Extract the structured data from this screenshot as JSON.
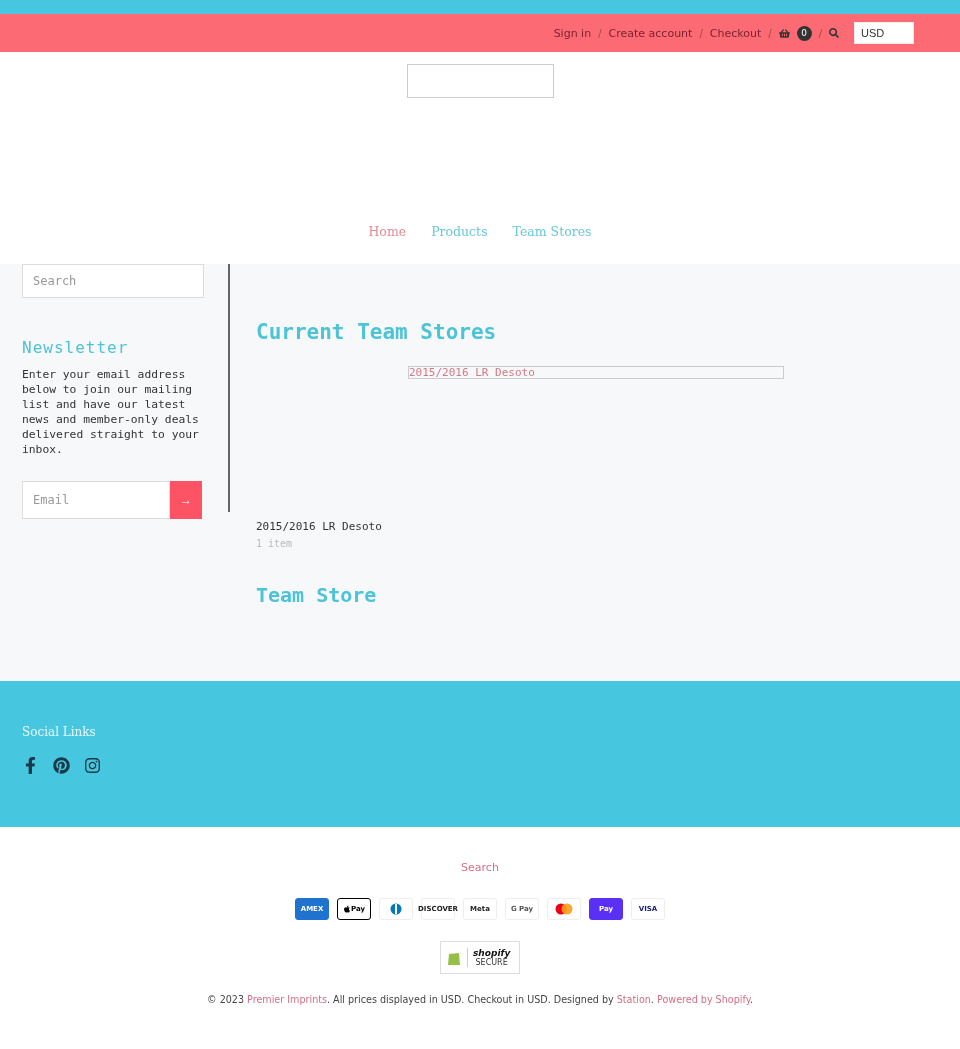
{
  "top_nav": {
    "links": [
      {
        "label": "Sign in"
      },
      {
        "label": "Create account"
      },
      {
        "label": "Checkout"
      }
    ],
    "separators": [
      "/",
      "/",
      "/",
      "/"
    ],
    "cart_count": "0",
    "currency": "USD"
  },
  "main_nav": [
    {
      "label": "Home",
      "selected": true
    },
    {
      "label": "Products",
      "selected": false
    },
    {
      "label": "Team Stores",
      "selected": false
    }
  ],
  "sidebar": {
    "search_placeholder": "Search",
    "newsletter_title": "Newsletter",
    "newsletter_text": "Enter your email address below to join our mailing list and have our latest news and member-only deals delivered straight to your inbox.",
    "email_placeholder": "Email",
    "submit_label": "→"
  },
  "content": {
    "title": "Current Team Stores",
    "collections": [
      {
        "image_alt": "2015/2016 LR Desoto",
        "name": "2015/2016 LR Desoto",
        "count": "1 item"
      }
    ],
    "section_title": "Team Store"
  },
  "footer": {
    "social_title": "Social Links",
    "search_link": "Search",
    "payments": [
      {
        "kind": "amex",
        "label": "AMEX"
      },
      {
        "kind": "applepay",
        "label": "Pay"
      },
      {
        "kind": "diners"
      },
      {
        "kind": "discover",
        "label": "DISCOVER"
      },
      {
        "kind": "meta",
        "label": "Meta"
      },
      {
        "kind": "gpay",
        "label": "G Pay"
      },
      {
        "kind": "mastercard"
      },
      {
        "kind": "shoppay",
        "label": "Pay"
      },
      {
        "kind": "visa",
        "label": "VISA"
      }
    ],
    "badge": {
      "title": "shopify",
      "subtitle": "SECURE"
    },
    "copyright": [
      {
        "kind": "text",
        "text": "© 2023 "
      },
      {
        "kind": "link",
        "text": "Premier Imprints"
      },
      {
        "kind": "text",
        "text": ". All prices displayed in USD. Checkout in USD. Designed by "
      },
      {
        "kind": "link",
        "text": "Station"
      },
      {
        "kind": "text",
        "text": ". "
      },
      {
        "kind": "link",
        "text": "Powered by Shopify"
      },
      {
        "kind": "text",
        "text": "."
      }
    ]
  }
}
